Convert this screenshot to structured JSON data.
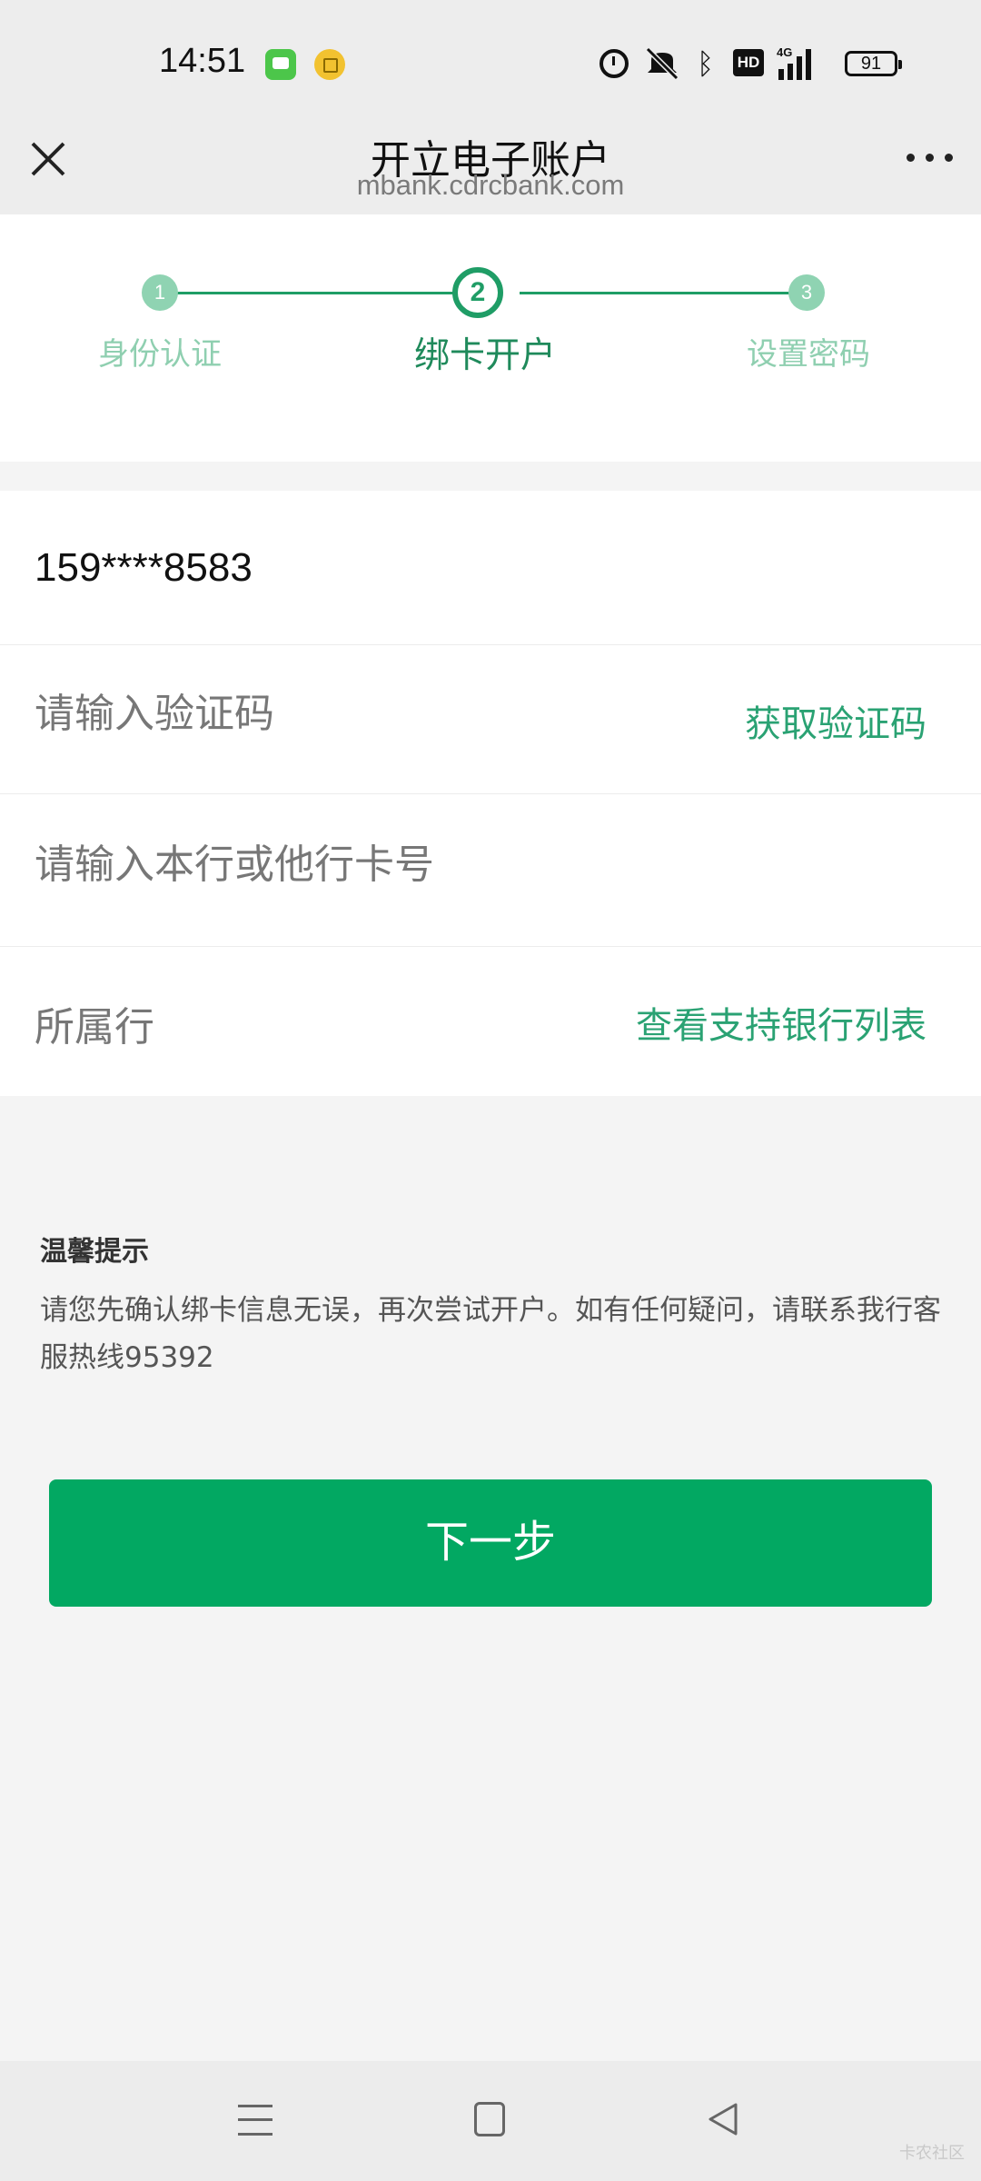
{
  "status_bar": {
    "time": "14:51",
    "network": "4G",
    "battery": "91",
    "icons": [
      "message-app-icon",
      "notification-icon",
      "alarm-icon",
      "mute-vibrate-icon",
      "bluetooth-icon",
      "hd-icon",
      "signal-icon",
      "battery-icon"
    ]
  },
  "header": {
    "title": "开立电子账户",
    "subtitle": "mbank.cdrcbank.com",
    "close_icon": "close-icon",
    "more_icon": "more-icon"
  },
  "stepper": {
    "steps": [
      {
        "number": "1",
        "label": "身份认证",
        "state": "done"
      },
      {
        "number": "2",
        "label": "绑卡开户",
        "state": "active"
      },
      {
        "number": "3",
        "label": "设置密码",
        "state": "pending"
      }
    ],
    "accent": "#1f9d66"
  },
  "form": {
    "phone": "159****8583",
    "code_placeholder": "请输入验证码",
    "get_code_label": "获取验证码",
    "card_placeholder": "请输入本行或他行卡号",
    "bank_label": "所属行",
    "bank_list_label": "查看支持银行列表"
  },
  "tips": {
    "title": "温馨提示",
    "text": "请您先确认绑卡信息无误，再次尝试开户。如有任何疑问，请联系我行客服热线95392"
  },
  "actions": {
    "next_label": "下一步",
    "button_color": "#02a862"
  },
  "watermark": "卡农社区"
}
